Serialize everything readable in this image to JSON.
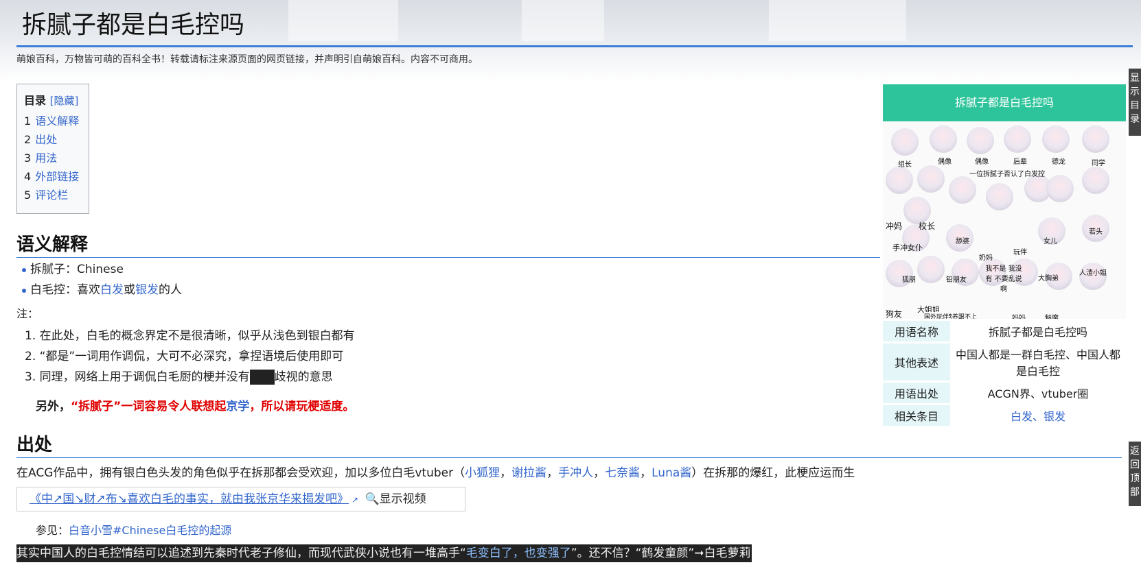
{
  "page": {
    "title": "拆腻子都是白毛控吗",
    "subtitle": "萌娘百科，万物皆可萌的百科全书！转载请标注来源页面的网页链接，并声明引自萌娘百科。内容不可商用。"
  },
  "toc": {
    "heading": "目录",
    "hide_label": "[隐藏]",
    "items": [
      {
        "num": "1",
        "label": "语义解释"
      },
      {
        "num": "2",
        "label": "出处"
      },
      {
        "num": "3",
        "label": "用法"
      },
      {
        "num": "4",
        "label": "外部链接"
      },
      {
        "num": "5",
        "label": "评论栏"
      }
    ]
  },
  "section_meaning": {
    "heading": "语义解释",
    "bullet1_prefix": "拆腻子：",
    "bullet1_value": "Chinese",
    "bullet2_prefix": "白毛控：喜欢",
    "bullet2_link1": "白发",
    "bullet2_mid": "或",
    "bullet2_link2": "银发",
    "bullet2_suffix": "的人",
    "note_label": "注：",
    "note1": "1. 在此处，白毛的概念界定不是很清晰，似乎从浅色到银白都有",
    "note2": "2. “都是”一词用作调侃，大可不必深究，拿捏语境后使用即可",
    "note3_before": "3. 同理，网络上用于调侃白毛厨的梗并没有",
    "note3_after": "歧视的意思",
    "extra_prefix": "另外，",
    "extra_red1": "“拆腻子”一词容易令人联想起",
    "extra_link": "京学",
    "extra_red2": "，所以请玩梗适度。"
  },
  "section_origin": {
    "heading": "出处",
    "text_before": "在ACG作品中，拥有银白色头发的角色似乎在拆那都会受欢迎，加以多位白毛vtuber（",
    "vtubers": [
      "小狐狸",
      "谢拉酱",
      "手冲人",
      "七奈酱",
      "Luna酱"
    ],
    "separator": "，",
    "text_after": "）在拆那的爆红，此梗应运而生",
    "video_link": "《中↗国↘财↗布↘喜欢白毛的事实，就由我张京华来揭发吧》",
    "video_ext_icon": "external-link-icon",
    "show_video_label": "显示视频",
    "seealso_prefix": "参见：",
    "seealso_link": "白音小雪#Chinese白毛控的起源",
    "dark_before": "其实中国人的白毛控情结可以追述到先秦时代老子修仙，而现代武侠小说也有一堆高手“",
    "dark_link": "毛变白了，也变强了",
    "dark_after": "”。还不信？“鹤发童颜”➞白毛萝莉"
  },
  "infobox": {
    "title": "拆腻子都是白毛控吗",
    "image_caption_top": "一位拆腻子否认了白发控",
    "image_labels": [
      "组长",
      "偶像",
      "偶像",
      "后辈",
      "德龙",
      "同学",
      "冲妈",
      "校长",
      "舔婆",
      "女儿",
      "若头",
      "手冲女仆",
      "玩伴",
      "狐朋",
      "铅朋友",
      "奶妈",
      "大胸弟",
      "人渣小姐",
      "狗友",
      "大姐姐",
      "营养跟不上",
      "妈妈",
      "魅魔",
      "国外玩伴"
    ],
    "image_caption_mid": "我不是 我没有 不要乱说啊",
    "rows": [
      {
        "key": "用语名称",
        "value": "拆腻子都是白毛控吗"
      },
      {
        "key": "其他表述",
        "value": "中国人都是一群白毛控、中国人都是白毛控"
      },
      {
        "key": "用语出处",
        "value": "ACGN界、vtuber圈"
      },
      {
        "key": "相关条目",
        "value": "白发、银发"
      }
    ]
  },
  "side_tabs": {
    "show_toc": "显示目录",
    "back_top": "返回顶部"
  },
  "colors": {
    "accent": "#3a7dd8",
    "infobox_title_bg": "#2ec49b",
    "link": "#3366cc",
    "warning": "#e00000"
  }
}
